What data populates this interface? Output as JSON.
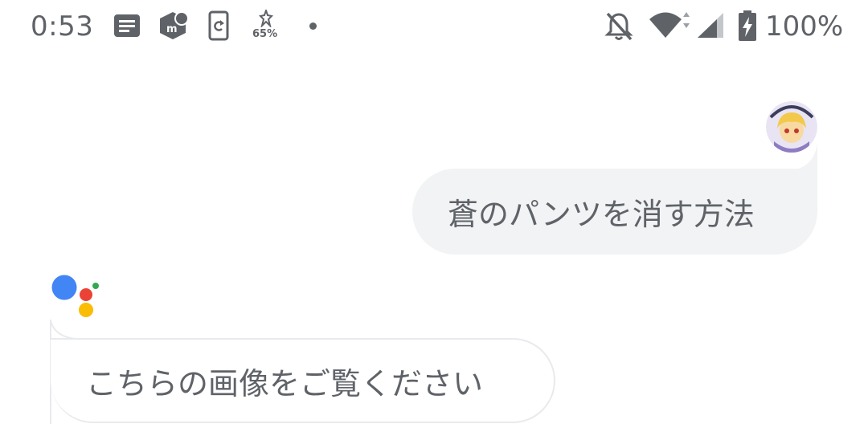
{
  "status_bar": {
    "time": "0:53",
    "small_battery_percent": "65%",
    "battery_percent": "100%",
    "icons": [
      "notes-icon",
      "mercari-icon",
      "sync-icon",
      "battery-saver-icon",
      "notification-dot",
      "do-not-disturb-icon",
      "wifi-icon",
      "signal-icon",
      "battery-charging-icon"
    ]
  },
  "conversation": {
    "user_message": "蒼のパンツを消す方法",
    "assistant_message": "こちらの画像をご覧ください"
  },
  "colors": {
    "text": "#5f6368",
    "user_bubble": "#f1f3f4",
    "assistant_border": "#e8eaed",
    "google_blue": "#4285f4",
    "google_red": "#ea4335",
    "google_yellow": "#fbbc04",
    "google_green": "#34a853"
  }
}
